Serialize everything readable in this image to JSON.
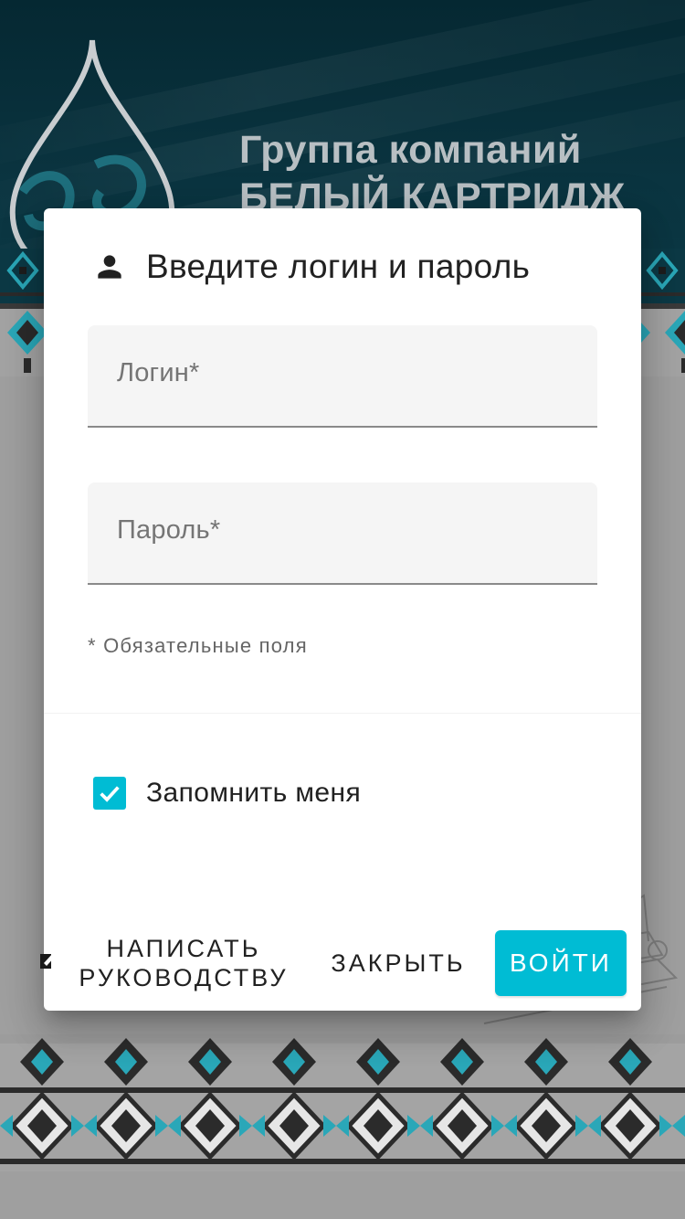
{
  "background": {
    "brand_line1": "Группа компаний",
    "brand_line2": "БЕЛЫЙ КАРТРИДЖ"
  },
  "dialog": {
    "title": "Введите логин и пароль",
    "title_icon": "person-icon",
    "login": {
      "placeholder": "Логин*",
      "value": ""
    },
    "password": {
      "placeholder": "Пароль*",
      "value": ""
    },
    "required_note": "* Обязательные поля",
    "remember": {
      "label": "Запомнить меня",
      "checked": true
    },
    "actions": {
      "write_line1": "НАПИСАТЬ",
      "write_line2": "РУКОВОДСТВУ",
      "close": "ЗАКРЫТЬ",
      "login": "ВОЙТИ"
    }
  },
  "colors": {
    "accent": "#00bcd4",
    "banner": "#0a3440",
    "backdrop": "#9f9f9f"
  }
}
